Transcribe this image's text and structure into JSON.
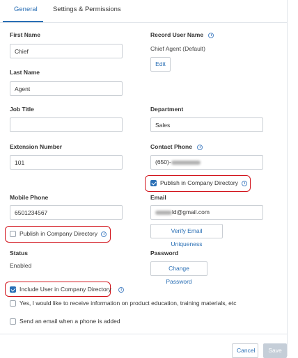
{
  "tabs": [
    {
      "label": "General",
      "active": true
    },
    {
      "label": "Settings & Permissions",
      "active": false
    }
  ],
  "fields": {
    "first_name": {
      "label": "First Name",
      "value": "Chief"
    },
    "last_name": {
      "label": "Last Name",
      "value": "Agent"
    },
    "job_title": {
      "label": "Job Title",
      "value": ""
    },
    "extension_number": {
      "label": "Extension Number",
      "value": "101"
    },
    "mobile_phone": {
      "label": "Mobile Phone",
      "value": "6501234567"
    },
    "record_user_name": {
      "label": "Record User Name",
      "value": "Chief Agent (Default)",
      "edit_label": "Edit"
    },
    "department": {
      "label": "Department",
      "value": "Sales"
    },
    "contact_phone": {
      "label": "Contact Phone",
      "value_visible": "(650)-"
    },
    "email": {
      "label": "Email",
      "value_visible": "ld@gmail.com",
      "verify_label": "Verify Email Uniqueness"
    },
    "status": {
      "label": "Status",
      "value": "Enabled"
    },
    "password": {
      "label": "Password",
      "change_label": "Change Password"
    }
  },
  "checkboxes": {
    "publish_contact_phone": {
      "label": "Publish in Company Directory",
      "checked": true
    },
    "publish_mobile_phone": {
      "label": "Publish in Company Directory",
      "checked": false
    },
    "include_user": {
      "label": "Include User in Company Directory",
      "checked": true
    },
    "receive_info": {
      "label": "Yes, I would like to receive information on product education, training materials, etc",
      "checked": false
    },
    "send_email": {
      "label": "Send an email when a phone is added",
      "checked": false
    }
  },
  "footer": {
    "cancel_label": "Cancel",
    "save_label": "Save"
  },
  "icons": {
    "info": "info-icon",
    "check": "check-icon"
  },
  "colors": {
    "accent": "#2a6fb5",
    "highlight": "#d2141c",
    "disabled": "#c5ced8"
  }
}
